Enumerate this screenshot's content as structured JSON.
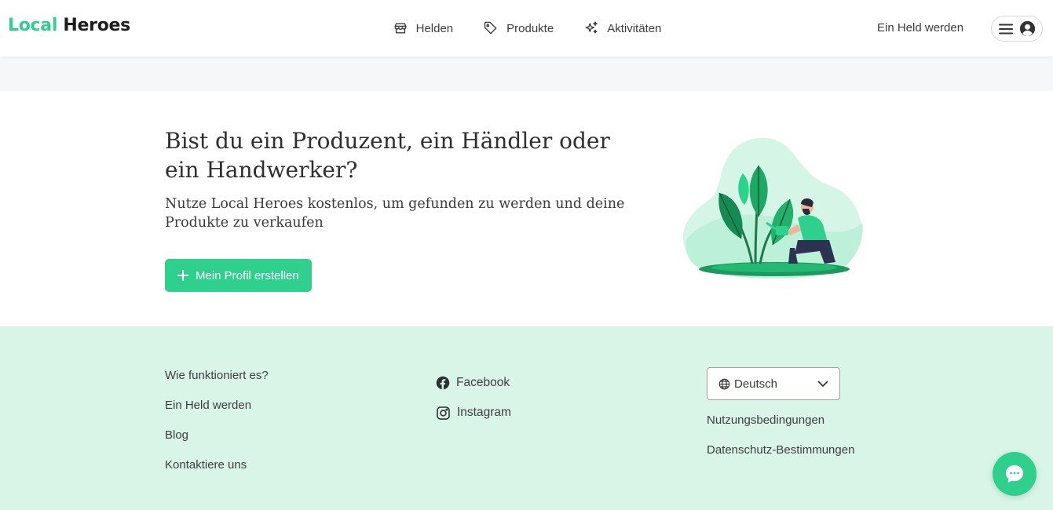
{
  "header": {
    "logo_part1": "Local",
    "logo_part2": "Heroes",
    "nav": [
      {
        "label": "Helden",
        "icon": "store-icon"
      },
      {
        "label": "Produkte",
        "icon": "tag-icon"
      },
      {
        "label": "Aktivitäten",
        "icon": "sparkles-icon"
      }
    ],
    "become_hero": "Ein Held werden"
  },
  "hero": {
    "title": "Bist du ein Produzent, ein Händler oder ein Handwerker?",
    "subtitle": "Nutze Local Heroes kostenlos, um gefunden zu werden und deine Produkte zu verkaufen",
    "cta_label": "Mein Profil erstellen"
  },
  "footer": {
    "links": [
      "Wie funktioniert es?",
      "Ein Held werden",
      "Blog",
      "Kontaktiere uns"
    ],
    "social": [
      {
        "label": "Facebook",
        "icon": "facebook-icon"
      },
      {
        "label": "Instagram",
        "icon": "instagram-icon"
      }
    ],
    "language": "Deutsch",
    "legal": [
      "Nutzungsbedingungen",
      "Datenschutz-Bestimmungen"
    ]
  },
  "colors": {
    "accent": "#2fd08e",
    "footer_bg": "#d9f5e8",
    "band_bg": "#f6f7f8"
  }
}
